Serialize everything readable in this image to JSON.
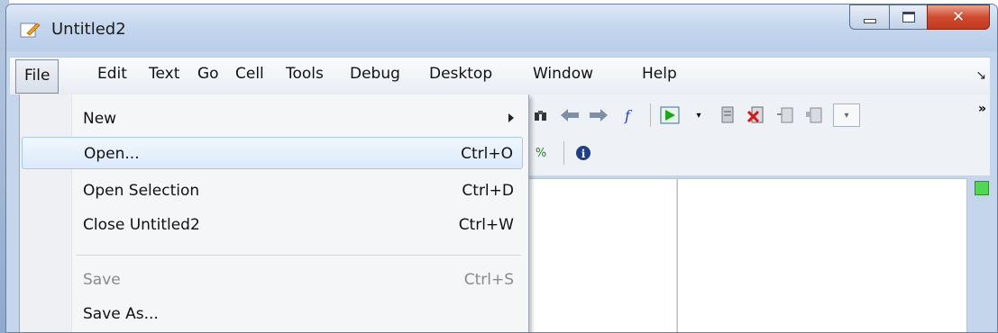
{
  "window": {
    "title": "Untitled2",
    "icon": "editor-document-icon",
    "controls": {
      "minimize": "minimize-icon",
      "maximize": "maximize-icon",
      "close": "✕"
    }
  },
  "menubar": {
    "items": [
      "File",
      "Edit",
      "Text",
      "Go",
      "Cell",
      "Tools",
      "Debug",
      "Desktop",
      "Window",
      "Help"
    ],
    "active": "File",
    "dock_arrow": "↘"
  },
  "file_menu": {
    "items": [
      {
        "label": "New",
        "shortcut": "",
        "submenu": true,
        "enabled": true
      },
      {
        "label": "Open...",
        "shortcut": "Ctrl+O",
        "enabled": true,
        "highlighted": true
      },
      {
        "label": "Open Selection",
        "shortcut": "Ctrl+D",
        "enabled": true
      },
      {
        "label": "Close Untitled2",
        "shortcut": "Ctrl+W",
        "enabled": true
      },
      {
        "label": "Save",
        "shortcut": "Ctrl+S",
        "enabled": false
      },
      {
        "label": "Save As...",
        "shortcut": "",
        "enabled": true
      }
    ]
  },
  "toolbar": {
    "row1_icons": [
      "find-icon",
      "back-arrow-icon",
      "forward-arrow-icon",
      "function-icon",
      "run-icon",
      "run-dropdown-icon",
      "step-icon",
      "clear-breakpoint-icon",
      "step-in-icon",
      "step-out-icon",
      "stack-combo-icon"
    ],
    "overflow": "»",
    "row2_icons": [
      "cell-percent-icon",
      "info-icon"
    ]
  },
  "colors": {
    "title_bar": "#c6d7ee",
    "close_button": "#cf4a2f",
    "menu_highlight": "#dbeafb",
    "green_indicator": "#53d653"
  }
}
